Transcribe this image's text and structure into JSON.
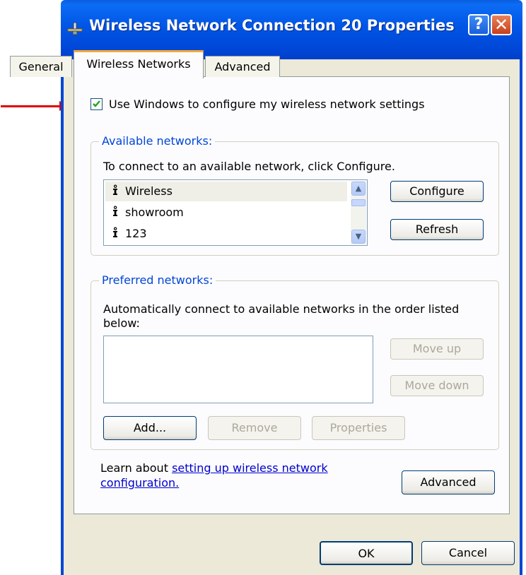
{
  "window": {
    "title": "Wireless Network Connection 20 Properties",
    "help_label": "?",
    "close_label": "✕"
  },
  "tabs": [
    {
      "label": "General",
      "active": false
    },
    {
      "label": "Wireless Networks",
      "active": true
    },
    {
      "label": "Advanced",
      "active": false
    }
  ],
  "use_windows_checkbox": {
    "label": "Use Windows to configure my wireless network settings",
    "checked": true
  },
  "available_networks": {
    "title": "Available networks:",
    "instruction": "To connect to an available network, click Configure.",
    "networks": [
      {
        "name": "Wireless",
        "selected": true
      },
      {
        "name": "showroom",
        "selected": false
      },
      {
        "name": "123",
        "selected": false
      }
    ],
    "configure_label": "Configure",
    "refresh_label": "Refresh"
  },
  "preferred_networks": {
    "title": "Preferred networks:",
    "instruction_line1": "Automatically connect to available networks in the order listed",
    "instruction_line2": "below:",
    "move_up_label": "Move up",
    "move_down_label": "Move down",
    "add_label": "Add...",
    "remove_label": "Remove",
    "properties_label": "Properties"
  },
  "learn_about": {
    "prefix": "Learn about ",
    "link_line1": "setting up wireless network",
    "link_line2": "configuration."
  },
  "advanced_button_label": "Advanced",
  "ok_label": "OK",
  "cancel_label": "Cancel",
  "colors": {
    "titlebar": "#0055e5",
    "dialog_bg": "#ece9d8",
    "group_title": "#0046d5",
    "annotation_arrow": "#e00000"
  }
}
